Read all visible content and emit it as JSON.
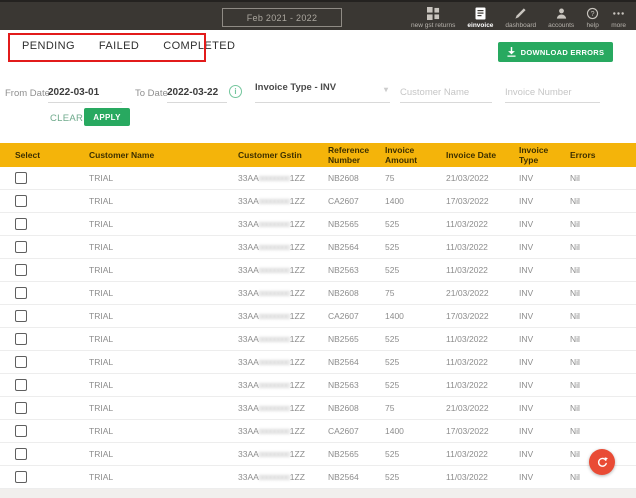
{
  "topbar": {
    "period_label": "Feb 2021 - 2022",
    "nav_items": [
      {
        "label": "new gst returns",
        "icon": "grid-icon",
        "active": false
      },
      {
        "label": "einvoice",
        "icon": "document-icon",
        "active": true
      },
      {
        "label": "dashboard",
        "icon": "pencil-icon",
        "active": false
      },
      {
        "label": "accounts",
        "icon": "person-icon",
        "active": false
      },
      {
        "label": "help",
        "icon": "help-icon",
        "active": false
      },
      {
        "label": "more",
        "icon": "more-icon",
        "active": false
      }
    ]
  },
  "tabs": [
    "PENDING",
    "FAILED",
    "COMPLETED"
  ],
  "toolbar": {
    "download_label": "DOWNLOAD ERRORS"
  },
  "filters": {
    "from_date_label": "From Date",
    "from_date_value": "2022-03-01",
    "to_date_label": "To Date",
    "to_date_value": "2022-03-22",
    "info_icon_glyph": "i",
    "invoice_type_value": "Invoice Type - INV",
    "customer_name_placeholder": "Customer Name",
    "invoice_number_placeholder": "Invoice Number",
    "clear_label": "CLEAR",
    "apply_label": "APPLY"
  },
  "table": {
    "columns": [
      "Select",
      "Customer Name",
      "Customer Gstin",
      "Reference Number",
      "Invoice Amount",
      "Invoice Date",
      "Invoice Type",
      "Errors"
    ],
    "rows": [
      {
        "customer": "TRIAL",
        "gstin_prefix": "33AA",
        "gstin_masked": "00000000",
        "gstin_suffix": "1ZZ",
        "reference": "NB2608",
        "amount": "75",
        "date": "21/03/2022",
        "type": "INV",
        "errors": "Nil"
      },
      {
        "customer": "TRIAL",
        "gstin_prefix": "33AA",
        "gstin_masked": "00000000",
        "gstin_suffix": "1ZZ",
        "reference": "CA2607",
        "amount": "1400",
        "date": "17/03/2022",
        "type": "INV",
        "errors": "Nil"
      },
      {
        "customer": "TRIAL",
        "gstin_prefix": "33AA",
        "gstin_masked": "00000000",
        "gstin_suffix": "1ZZ",
        "reference": "NB2565",
        "amount": "525",
        "date": "11/03/2022",
        "type": "INV",
        "errors": "Nil"
      },
      {
        "customer": "TRIAL",
        "gstin_prefix": "33AA",
        "gstin_masked": "00000000",
        "gstin_suffix": "1ZZ",
        "reference": "NB2564",
        "amount": "525",
        "date": "11/03/2022",
        "type": "INV",
        "errors": "Nil"
      },
      {
        "customer": "TRIAL",
        "gstin_prefix": "33AA",
        "gstin_masked": "00000000",
        "gstin_suffix": "1ZZ",
        "reference": "NB2563",
        "amount": "525",
        "date": "11/03/2022",
        "type": "INV",
        "errors": "Nil"
      },
      {
        "customer": "TRIAL",
        "gstin_prefix": "33AA",
        "gstin_masked": "00000000",
        "gstin_suffix": "1ZZ",
        "reference": "NB2608",
        "amount": "75",
        "date": "21/03/2022",
        "type": "INV",
        "errors": "Nil"
      },
      {
        "customer": "TRIAL",
        "gstin_prefix": "33AA",
        "gstin_masked": "00000000",
        "gstin_suffix": "1ZZ",
        "reference": "CA2607",
        "amount": "1400",
        "date": "17/03/2022",
        "type": "INV",
        "errors": "Nil"
      },
      {
        "customer": "TRIAL",
        "gstin_prefix": "33AA",
        "gstin_masked": "00000000",
        "gstin_suffix": "1ZZ",
        "reference": "NB2565",
        "amount": "525",
        "date": "11/03/2022",
        "type": "INV",
        "errors": "Nil"
      },
      {
        "customer": "TRIAL",
        "gstin_prefix": "33AA",
        "gstin_masked": "00000000",
        "gstin_suffix": "1ZZ",
        "reference": "NB2564",
        "amount": "525",
        "date": "11/03/2022",
        "type": "INV",
        "errors": "Nil"
      },
      {
        "customer": "TRIAL",
        "gstin_prefix": "33AA",
        "gstin_masked": "00000000",
        "gstin_suffix": "1ZZ",
        "reference": "NB2563",
        "amount": "525",
        "date": "11/03/2022",
        "type": "INV",
        "errors": "Nil"
      },
      {
        "customer": "TRIAL",
        "gstin_prefix": "33AA",
        "gstin_masked": "00000000",
        "gstin_suffix": "1ZZ",
        "reference": "NB2608",
        "amount": "75",
        "date": "21/03/2022",
        "type": "INV",
        "errors": "Nil"
      },
      {
        "customer": "TRIAL",
        "gstin_prefix": "33AA",
        "gstin_masked": "00000000",
        "gstin_suffix": "1ZZ",
        "reference": "CA2607",
        "amount": "1400",
        "date": "17/03/2022",
        "type": "INV",
        "errors": "Nil"
      },
      {
        "customer": "TRIAL",
        "gstin_prefix": "33AA",
        "gstin_masked": "00000000",
        "gstin_suffix": "1ZZ",
        "reference": "NB2565",
        "amount": "525",
        "date": "11/03/2022",
        "type": "INV",
        "errors": "Nil"
      },
      {
        "customer": "TRIAL",
        "gstin_prefix": "33AA",
        "gstin_masked": "00000000",
        "gstin_suffix": "1ZZ",
        "reference": "NB2564",
        "amount": "525",
        "date": "11/03/2022",
        "type": "INV",
        "errors": "Nil"
      }
    ]
  },
  "colors": {
    "topbar_dark": "#3a3733",
    "header_yellow": "#F4B40A",
    "accent_green": "#28a960",
    "annotation_red": "#e21b1b",
    "fab_red": "#e94b35"
  }
}
